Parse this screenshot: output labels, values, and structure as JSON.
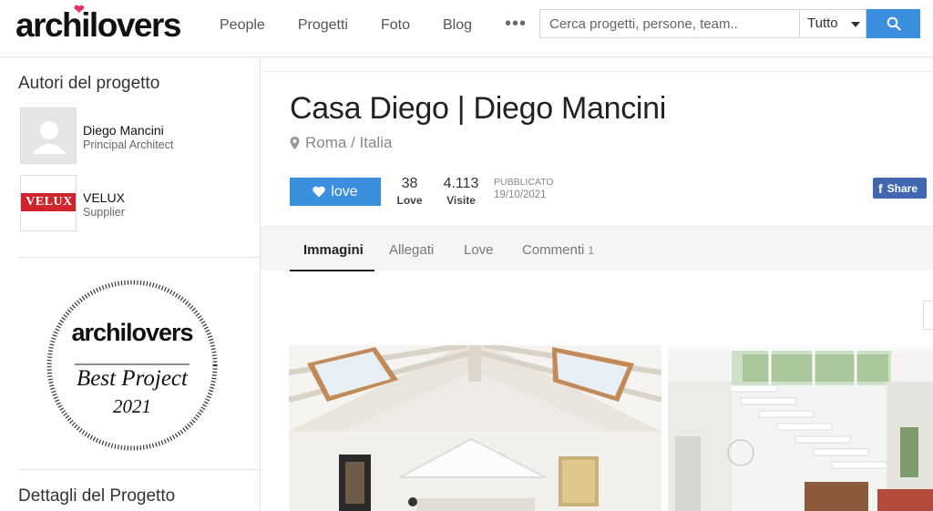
{
  "header": {
    "logo": "archilovers",
    "nav": [
      "People",
      "Progetti",
      "Foto",
      "Blog"
    ],
    "more": "•••",
    "search_placeholder": "Cerca progetti, persone, team..",
    "filter_value": "Tutto"
  },
  "sidebar": {
    "authors_title": "Autori del progetto",
    "authors": [
      {
        "name": "Diego Mancini",
        "role": "Principal Architect"
      },
      {
        "name": "VELUX",
        "role": "Supplier"
      }
    ],
    "velux_logo_text": "VELUX",
    "badge": {
      "brand": "archilovers",
      "line1": "Best Project",
      "year": "2021"
    },
    "details_title": "Dettagli del Progetto"
  },
  "project": {
    "title": "Casa Diego | Diego Mancini",
    "location": "Roma / Italia",
    "love_label": "love",
    "love_count": "38",
    "love_count_label": "Love",
    "visits": "4.113",
    "visits_label": "Visite",
    "published_label": "PUBBLICATO",
    "published_date": "19/10/2021",
    "share_label": "Share"
  },
  "tabs": [
    {
      "label": "Immagini",
      "count": ""
    },
    {
      "label": "Allegati",
      "count": ""
    },
    {
      "label": "Love",
      "count": ""
    },
    {
      "label": "Commenti",
      "count": "1"
    }
  ],
  "colors": {
    "accent": "#3b8fde",
    "facebook": "#4267b2",
    "heart": "#e2336b"
  }
}
